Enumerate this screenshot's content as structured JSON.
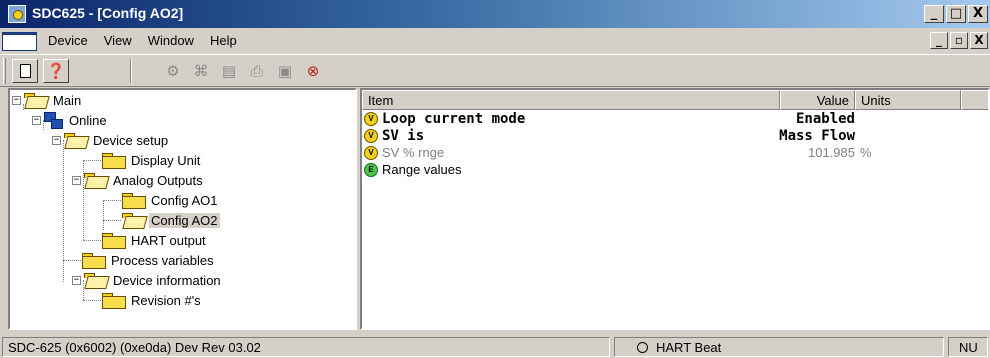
{
  "window": {
    "title": "SDC625 - [Config AO2]",
    "controls": [
      "_",
      "□",
      "X"
    ],
    "mdi_controls": [
      "_",
      "▫",
      "X"
    ]
  },
  "menu": {
    "items": [
      "Device",
      "View",
      "Window",
      "Help"
    ]
  },
  "toolbar": {
    "buttons": [
      "new-icon",
      "help-cursor-icon",
      "device-icon",
      "scan-icon",
      "open-folder-icon",
      "print-icon",
      "save-icon",
      "stop-icon"
    ]
  },
  "tree": {
    "nodes": [
      {
        "label": "Main",
        "expander": "−"
      },
      {
        "label": "Online",
        "expander": "−"
      },
      {
        "label": "Device setup",
        "expander": "−"
      },
      {
        "label": "Display Unit"
      },
      {
        "label": "Analog Outputs",
        "expander": "−"
      },
      {
        "label": "Config AO1"
      },
      {
        "label": "Config AO2",
        "selected": true
      },
      {
        "label": "HART output"
      },
      {
        "label": "Process variables"
      },
      {
        "label": "Device information",
        "expander": "−"
      },
      {
        "label": "Revision #'s"
      }
    ]
  },
  "list": {
    "headers": {
      "item": "Item",
      "value": "Value",
      "units": "Units"
    },
    "rows": [
      {
        "icon": "V",
        "name": "Loop current mode",
        "value": "Enabled",
        "units": "",
        "style": "bold"
      },
      {
        "icon": "V",
        "name": "SV is",
        "value": "Mass Flow",
        "units": "",
        "style": "bold"
      },
      {
        "icon": "V",
        "name": "SV % rnge",
        "value": "101.985",
        "units": "%",
        "style": "grey"
      },
      {
        "icon": "E",
        "name": "Range values",
        "value": "",
        "units": "",
        "style": "normal"
      }
    ]
  },
  "status": {
    "device": "SDC-625   (0x6002)  (0xe0da) Dev Rev 03.02",
    "hart": "HART Beat",
    "num": "NU"
  },
  "colors": {
    "title_start": "#0a246a",
    "title_end": "#a6caf0",
    "chrome": "#d4d0c8",
    "folder": "#f7dc4b"
  }
}
